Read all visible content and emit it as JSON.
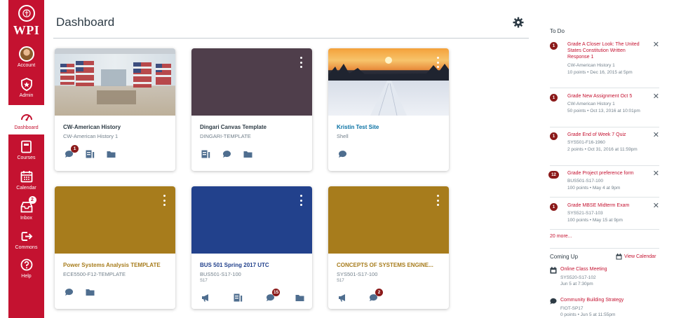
{
  "nav": {
    "logo_text": "WPI",
    "items": [
      {
        "label": "Account"
      },
      {
        "label": "Admin"
      },
      {
        "label": "Dashboard"
      },
      {
        "label": "Courses"
      },
      {
        "label": "Calendar"
      },
      {
        "label": "Inbox",
        "badge": "2"
      },
      {
        "label": "Commons"
      },
      {
        "label": "Help"
      }
    ]
  },
  "header": {
    "title": "Dashboard"
  },
  "cards": [
    {
      "title": "CW-American History",
      "code": "CW-American History 1",
      "term": "",
      "color": "#e9eef1",
      "title_color": "#2d3b45",
      "badges": {
        "discussions": "1"
      }
    },
    {
      "title": "Dingari Canvas Template",
      "code": "DINGARI-TEMPLATE",
      "term": "",
      "color": "#4f3e4b",
      "title_color": "#2d3b45",
      "badges": {}
    },
    {
      "title": "Kristin Test Site",
      "code": "Shell",
      "term": "",
      "color": "#f0a040",
      "title_color": "#0770a3",
      "badges": {}
    },
    {
      "title": "Power Systems Analysis TEMPLATE",
      "code": "ECE5500-F12-TEMPLATE",
      "term": "",
      "color": "#a77c1c",
      "title_color": "#a77c1c",
      "badges": {}
    },
    {
      "title": "BUS 501 Spring 2017 UTC",
      "code": "BUS501-S17-100",
      "term": "S17",
      "color": "#22418c",
      "title_color": "#22418c",
      "badges": {
        "discussions": "15"
      }
    },
    {
      "title": "CONCEPTS OF SYSTEMS ENGINE...",
      "code": "SYS501-S17-100",
      "term": "S17",
      "color": "#a77c1c",
      "title_color": "#a77c1c",
      "badges": {
        "discussions": "2"
      }
    }
  ],
  "sidebar": {
    "todo_heading": "To Do",
    "todo": [
      {
        "count": "1",
        "title": "Grade A Closer Look: The United States Constitution Written Response 1",
        "course": "CW-American History 1",
        "meta": "10 points • Dec 16, 2015 at 5pm"
      },
      {
        "count": "1",
        "title": "Grade New Assignment Oct 5",
        "course": "CW-American History 1",
        "meta": "50 points • Oct 13, 2016 at 10:01pm"
      },
      {
        "count": "1",
        "title": "Grade End of Week 7 Quiz",
        "course": "SYS501-F16-1960",
        "meta": "2 points • Oct 31, 2016 at 11:59pm"
      },
      {
        "count": "12",
        "title": "Grade Project preference form",
        "course": "BUS501-S17-100",
        "meta": "100 points • May 4 at 9pm"
      },
      {
        "count": "1",
        "title": "Grade MBSE Midterm Exam",
        "course": "SYS521-S17-103",
        "meta": "100 points • May 15 at 9pm"
      }
    ],
    "more_link": "20 more...",
    "coming_up_heading": "Coming Up",
    "view_calendar": "View Calendar",
    "coming_up": [
      {
        "title": "Online Class Meeting",
        "course": "SYS520-S17-102",
        "meta": "Jun 5 at 7:30pm",
        "icon": "calendar-icon"
      },
      {
        "title": "Community Building Strategy",
        "course": "FIOT-SP17",
        "meta": "0 points • Jun 5 at 11:55pm",
        "icon": "discussion-icon"
      }
    ]
  },
  "colors": {
    "brand": "#c41230",
    "badge": "#8b1a1a",
    "icon": "#4f6e8f",
    "muted": "#73818c"
  }
}
